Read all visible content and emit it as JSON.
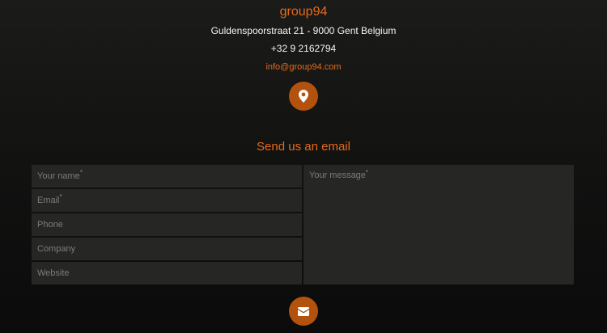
{
  "contact": {
    "company": "group94",
    "address": "Guldenspoorstraat 21 - 9000 Gent Belgium",
    "phone": "+32 9 2162794",
    "email": "info@group94.com"
  },
  "form": {
    "title": "Send us an email",
    "required_mark": "*",
    "name_placeholder": "Your name",
    "email_placeholder": "Email",
    "phone_placeholder": "Phone",
    "company_placeholder": "Company",
    "website_placeholder": "Website",
    "message_placeholder": "Your message"
  },
  "icons": {
    "location": "map-pin-icon",
    "send": "envelope-icon"
  },
  "colors": {
    "accent": "#e46a1b",
    "button": "#b2520d",
    "field_bg": "#262625",
    "placeholder": "#7c7c7a"
  }
}
